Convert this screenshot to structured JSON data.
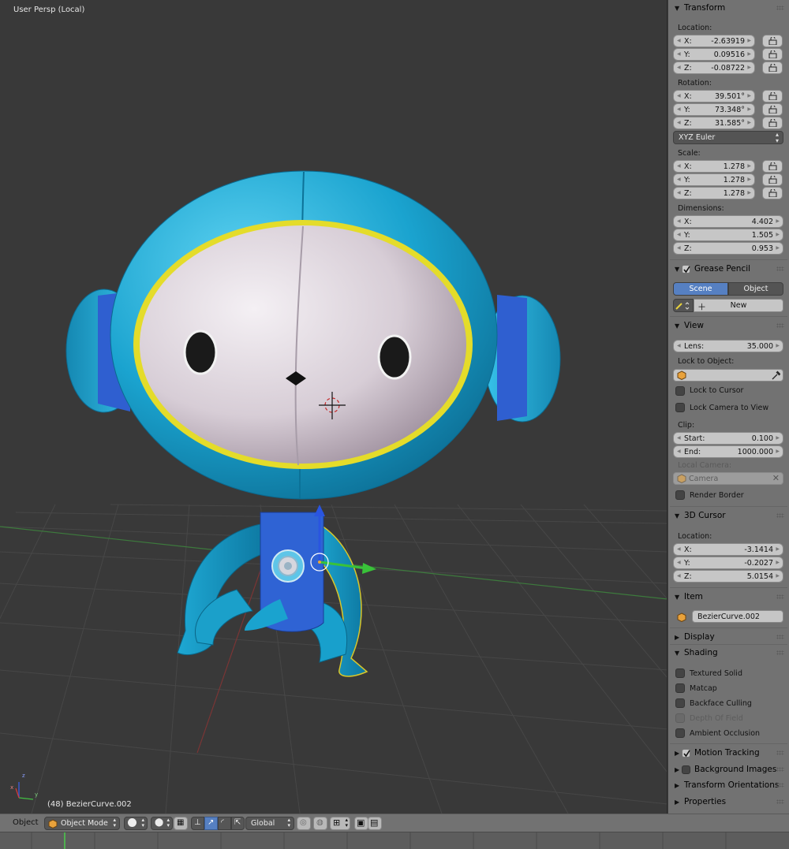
{
  "viewport": {
    "view_label": "User Persp (Local)",
    "object_info": "(48) BezierCurve.002",
    "axis_labels": {
      "x": "x",
      "y": "y",
      "z": "z"
    },
    "colors": {
      "body": "#1fa6cf",
      "ear_band": "#2f5fd0",
      "face": "#d8d2d8",
      "outline": "#e9e22a",
      "grid": "#4a4a4a"
    }
  },
  "npanel": {
    "transform": {
      "title": "Transform",
      "location_label": "Location:",
      "location": [
        {
          "k": "X:",
          "v": "-2.63919"
        },
        {
          "k": "Y:",
          "v": "0.09516"
        },
        {
          "k": "Z:",
          "v": "-0.08722"
        }
      ],
      "rotation_label": "Rotation:",
      "rotation": [
        {
          "k": "X:",
          "v": "39.501°"
        },
        {
          "k": "Y:",
          "v": "73.348°"
        },
        {
          "k": "Z:",
          "v": "31.585°"
        }
      ],
      "rotation_mode": "XYZ Euler",
      "scale_label": "Scale:",
      "scale": [
        {
          "k": "X:",
          "v": "1.278"
        },
        {
          "k": "Y:",
          "v": "1.278"
        },
        {
          "k": "Z:",
          "v": "1.278"
        }
      ],
      "dimensions_label": "Dimensions:",
      "dimensions": [
        {
          "k": "X:",
          "v": "4.402"
        },
        {
          "k": "Y:",
          "v": "1.505"
        },
        {
          "k": "Z:",
          "v": "0.953"
        }
      ]
    },
    "grease_pencil": {
      "title": "Grease Pencil",
      "scene_tab": "Scene",
      "object_tab": "Object",
      "new_button": "New"
    },
    "view": {
      "title": "View",
      "lens_label": "Lens:",
      "lens_value": "35.000",
      "lock_to_object_label": "Lock to Object:",
      "lock_to_cursor": "Lock to Cursor",
      "lock_camera_to_view": "Lock Camera to View",
      "clip_label": "Clip:",
      "clip_start_label": "Start:",
      "clip_start": "0.100",
      "clip_end_label": "End:",
      "clip_end": "1000.000",
      "local_camera_label": "Local Camera:",
      "camera_value": "Camera",
      "render_border": "Render Border"
    },
    "cursor": {
      "title": "3D Cursor",
      "location_label": "Location:",
      "location": [
        {
          "k": "X:",
          "v": "-3.1414"
        },
        {
          "k": "Y:",
          "v": "-0.2027"
        },
        {
          "k": "Z:",
          "v": "5.0154"
        }
      ]
    },
    "item": {
      "title": "Item",
      "name": "BezierCurve.002"
    },
    "display": {
      "title": "Display"
    },
    "shading": {
      "title": "Shading",
      "options": [
        {
          "label": "Textured Solid"
        },
        {
          "label": "Matcap"
        },
        {
          "label": "Backface Culling"
        },
        {
          "label": "Depth Of Field"
        },
        {
          "label": "Ambient Occlusion"
        }
      ]
    },
    "motion_tracking": {
      "title": "Motion Tracking"
    },
    "background_images": {
      "title": "Background Images"
    },
    "transform_orientations": {
      "title": "Transform Orientations"
    },
    "properties": {
      "title": "Properties"
    }
  },
  "header": {
    "menu_object": "Object",
    "mode": "Object Mode",
    "orientation": "Global"
  }
}
